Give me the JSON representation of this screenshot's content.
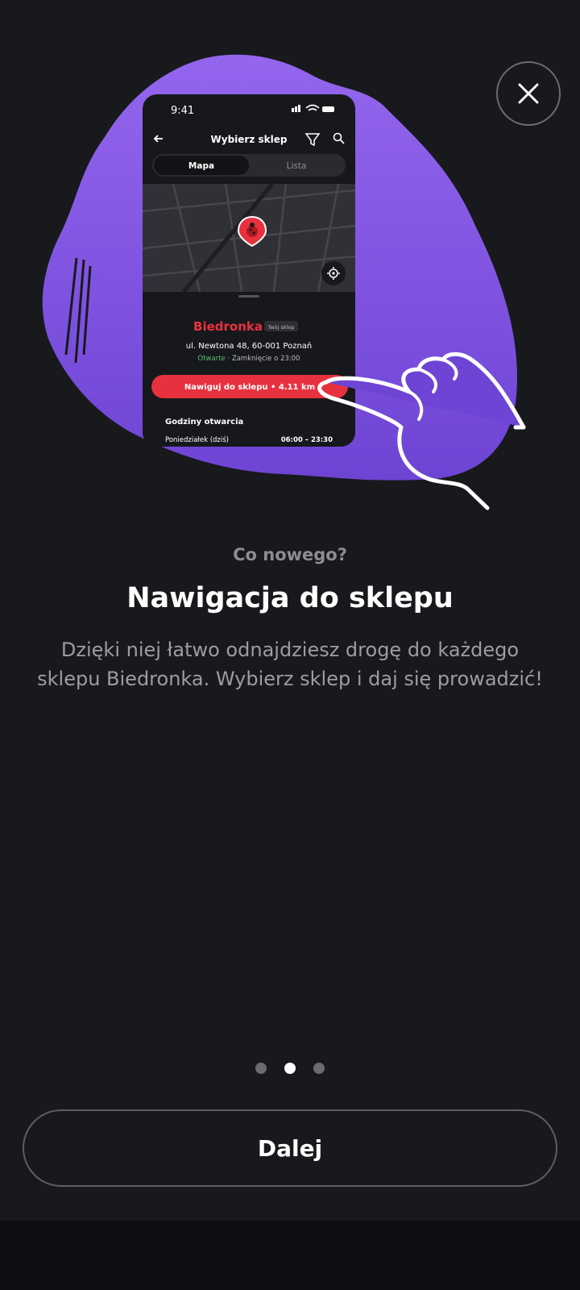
{
  "colors": {
    "background": "#18191d",
    "blob": "#8a5ce6",
    "accent_red": "#e8313f",
    "muted_text": "#9c9da3"
  },
  "illustration": {
    "phone": {
      "time": "9:41",
      "header_title": "Wybierz sklep",
      "tabs": [
        "Mapa",
        "Lista"
      ],
      "store_name": "Biedronka",
      "store_badge": "Twój sklep",
      "address": "ul. Newtona 48, 60-001 Poznań",
      "status_open": "Otwarte",
      "status_rest": " · Zamknięcie o 23:00",
      "navigate_button": "Nawiguj do sklepu • 4.11 km",
      "hours_title": "Godziny otwarcia",
      "hours_day": "Poniedziałek (dziś)",
      "hours_value": "06:00 – 23:30"
    }
  },
  "content": {
    "kicker": "Co nowego?",
    "title": "Nawigacja do sklepu",
    "description": "Dzięki niej łatwo odnajdziesz drogę do każdego sklepu Biedronka. Wybierz sklep i daj się prowadzić!"
  },
  "pagination": {
    "total": 3,
    "active": 2
  },
  "next_button_label": "Dalej",
  "icons": [
    "close-icon",
    "back-arrow-icon",
    "filter-icon",
    "search-icon",
    "map-pin-icon",
    "locate-icon",
    "hand-pointer-icon"
  ]
}
